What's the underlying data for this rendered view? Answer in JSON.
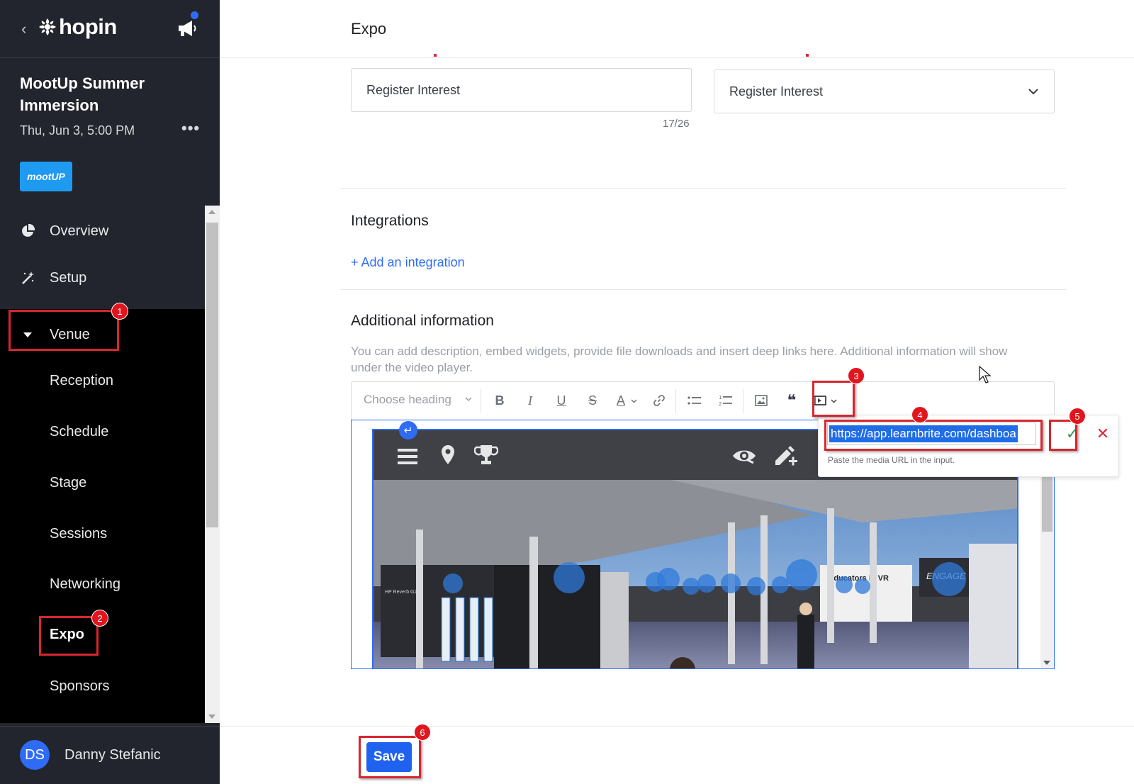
{
  "sidebar": {
    "brand": "hopin",
    "event_title": "MootUp Summer Immersion",
    "event_date": "Thu, Jun 3, 5:00 PM",
    "more_label": "•••",
    "event_logo_text": "mootUP",
    "nav": {
      "overview": "Overview",
      "setup": "Setup",
      "venue": "Venue",
      "sub_items": [
        "Reception",
        "Schedule",
        "Stage",
        "Sessions",
        "Networking",
        "Expo",
        "Sponsors"
      ]
    },
    "user": {
      "initials": "DS",
      "name": "Danny Stefanic"
    }
  },
  "main": {
    "page_title": "Expo",
    "button_text_value": "Register Interest",
    "char_count": "17/26",
    "button_action_value": "Register Interest",
    "integrations_title": "Integrations",
    "add_integration": "+ Add an integration",
    "additional_title": "Additional information",
    "additional_help": "You can add description, embed widgets, provide file downloads and insert deep links here. Additional information will show under the video player.",
    "toolbar": {
      "heading_placeholder": "Choose heading",
      "bold": "B",
      "italic": "I",
      "underline": "U",
      "strike": "S",
      "font_color": "A",
      "quote": "❝"
    },
    "media_popup": {
      "url_value": "https://app.learnbrite.com/dashboa",
      "hint": "Paste the media URL in the input.",
      "ok": "✓",
      "cancel": "✕"
    },
    "embed": {
      "sign_educators": "Educators in VR",
      "sign_engage": "ENGAGE",
      "sign_hp": "HP Reverb G2"
    },
    "save_label": "Save"
  },
  "annotations": {
    "steps": [
      "1",
      "2",
      "3",
      "4",
      "5",
      "6"
    ],
    "color": "#e0151e"
  },
  "colors": {
    "accent": "#2f6cf6",
    "sidebar_bg": "#22252d",
    "highlight": "#d7262f"
  }
}
